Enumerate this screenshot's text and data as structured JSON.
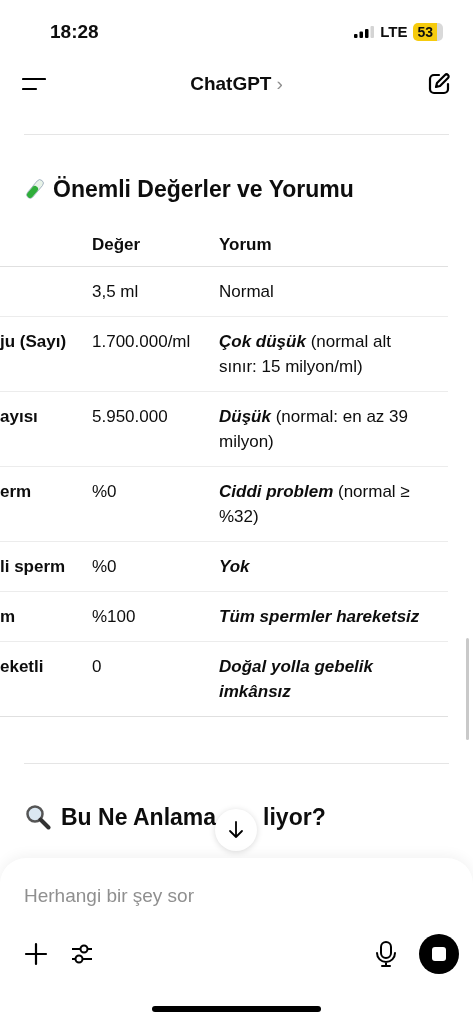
{
  "status_bar": {
    "time": "18:28",
    "network": "LTE",
    "battery": "53"
  },
  "header": {
    "title": "ChatGPT",
    "chevron": "›"
  },
  "section_heading": "Önemli Değerler ve Yorumu",
  "table": {
    "columns": [
      "Değer",
      "Yorum"
    ],
    "rows": [
      {
        "value": "3,5 ml",
        "comment": "Normal"
      },
      {
        "parameter": "ju (Sayı)",
        "value": "1.700.000/ml",
        "emphasis": "Çok düşük",
        "comment": "(normal alt sınır: 15 milyon/ml)"
      },
      {
        "parameter": "ayısı",
        "value": "5.950.000",
        "emphasis": "Düşük",
        "comment": "(normal: en az 39 milyon)"
      },
      {
        "parameter": "erm",
        "value": "%0",
        "emphasis": "Ciddi problem",
        "comment": "(normal ≥ %32)"
      },
      {
        "parameter": "li sperm",
        "value": "%0",
        "emphasis": "Yok"
      },
      {
        "parameter": "m",
        "value": "%100",
        "emphasis": "Tüm spermler hareketsiz"
      },
      {
        "parameter": "eketli",
        "value": "0",
        "emphasis": "Doğal yolla gebelik imkânsız"
      }
    ]
  },
  "next_heading": {
    "before": "Bu Ne Anlama",
    "after": "liyor?"
  },
  "composer": {
    "placeholder": "Herhangi bir şey sor"
  }
}
